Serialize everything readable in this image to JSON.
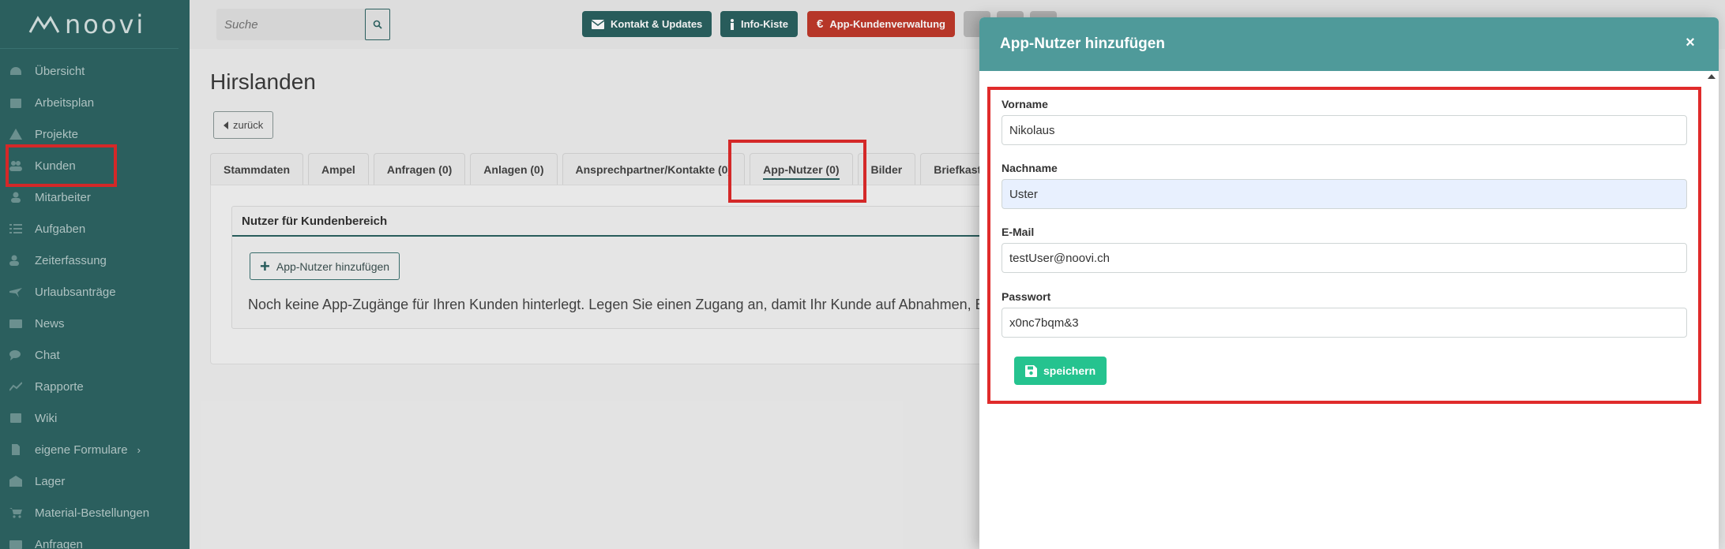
{
  "app": {
    "logo_text": "noovi"
  },
  "sidebar": {
    "items": [
      {
        "label": "Übersicht",
        "icon": "dashboard-icon"
      },
      {
        "label": "Arbeitsplan",
        "icon": "calendar-icon"
      },
      {
        "label": "Projekte",
        "icon": "warning-icon"
      },
      {
        "label": "Kunden",
        "icon": "users-icon"
      },
      {
        "label": "Mitarbeiter",
        "icon": "user-icon"
      },
      {
        "label": "Aufgaben",
        "icon": "list-icon"
      },
      {
        "label": "Zeiterfassung",
        "icon": "user-clock-icon"
      },
      {
        "label": "Urlaubsanträge",
        "icon": "plane-icon"
      },
      {
        "label": "News",
        "icon": "newspaper-icon"
      },
      {
        "label": "Chat",
        "icon": "chat-icon"
      },
      {
        "label": "Rapporte",
        "icon": "chart-icon"
      },
      {
        "label": "Wiki",
        "icon": "book-icon"
      },
      {
        "label": "eigene Formulare",
        "icon": "file-icon",
        "chevron": "›"
      },
      {
        "label": "Lager",
        "icon": "warehouse-icon"
      },
      {
        "label": "Material-Bestellungen",
        "icon": "cart-icon"
      },
      {
        "label": "Anfragen",
        "icon": "inbox-icon"
      }
    ]
  },
  "topbar": {
    "search_placeholder": "Suche",
    "buttons": {
      "kontakt": "Kontakt & Updates",
      "info": "Info-Kiste",
      "app_kunden": "App-Kundenverwaltung"
    }
  },
  "page": {
    "title": "Hirslanden",
    "back_label": "zurück",
    "tabs": [
      "Stammdaten",
      "Ampel",
      "Anfragen (0)",
      "Anlagen (0)",
      "Ansprechpartner/Kontakte (0)",
      "App-Nutzer (0)",
      "Bilder",
      "Briefkaste"
    ],
    "card_title": "Nutzer für Kundenbereich",
    "add_button": "App-Nutzer hinzufügen",
    "empty_text": "Noch keine App-Zugänge für Ihren Kunden hinterlegt. Legen Sie einen Zugang an, damit Ihr Kunde auf Abnahmen, Baut"
  },
  "modal": {
    "title": "App-Nutzer hinzufügen",
    "close_symbol": "×",
    "fields": {
      "vorname_label": "Vorname",
      "vorname_value": "Nikolaus",
      "nachname_label": "Nachname",
      "nachname_value": "Uster",
      "email_label": "E-Mail",
      "email_value": "testUser@noovi.ch",
      "passwort_label": "Passwort",
      "passwort_value": "x0nc7bqm&3"
    },
    "save_label": "speichern"
  },
  "colors": {
    "sidebar": "#2e6564",
    "modal_header": "#4f9a9a",
    "highlight": "#e02b2b",
    "save": "#25c38f",
    "danger": "#c0392b"
  }
}
